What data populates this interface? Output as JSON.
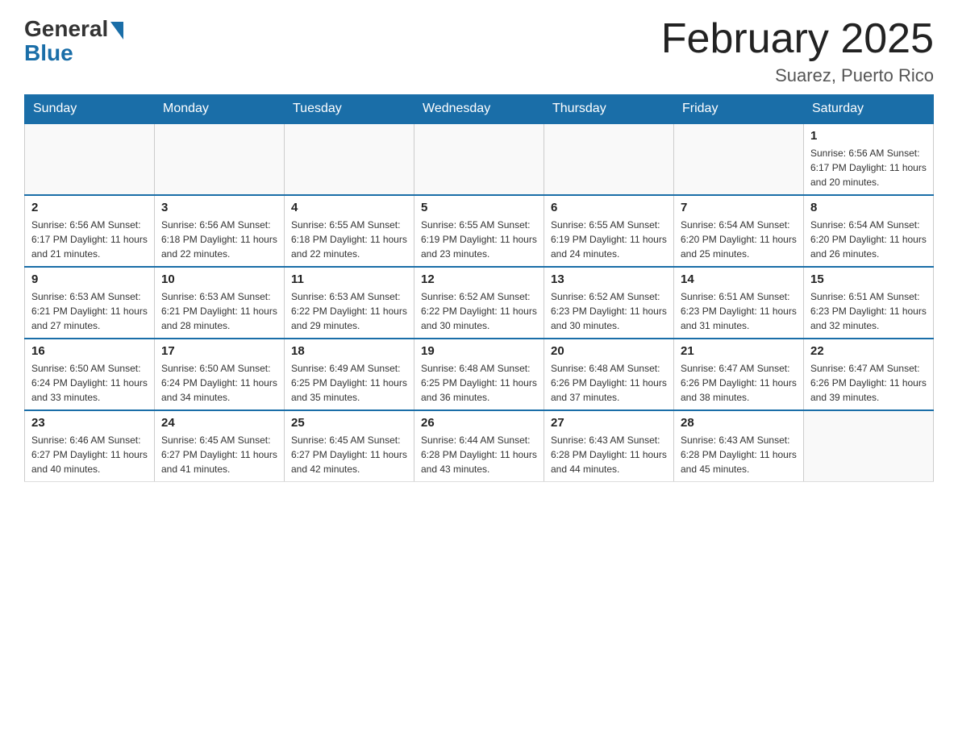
{
  "logo": {
    "general": "General",
    "blue": "Blue"
  },
  "title": "February 2025",
  "subtitle": "Suarez, Puerto Rico",
  "days_of_week": [
    "Sunday",
    "Monday",
    "Tuesday",
    "Wednesday",
    "Thursday",
    "Friday",
    "Saturday"
  ],
  "weeks": [
    [
      {
        "day": "",
        "info": ""
      },
      {
        "day": "",
        "info": ""
      },
      {
        "day": "",
        "info": ""
      },
      {
        "day": "",
        "info": ""
      },
      {
        "day": "",
        "info": ""
      },
      {
        "day": "",
        "info": ""
      },
      {
        "day": "1",
        "info": "Sunrise: 6:56 AM\nSunset: 6:17 PM\nDaylight: 11 hours\nand 20 minutes."
      }
    ],
    [
      {
        "day": "2",
        "info": "Sunrise: 6:56 AM\nSunset: 6:17 PM\nDaylight: 11 hours\nand 21 minutes."
      },
      {
        "day": "3",
        "info": "Sunrise: 6:56 AM\nSunset: 6:18 PM\nDaylight: 11 hours\nand 22 minutes."
      },
      {
        "day": "4",
        "info": "Sunrise: 6:55 AM\nSunset: 6:18 PM\nDaylight: 11 hours\nand 22 minutes."
      },
      {
        "day": "5",
        "info": "Sunrise: 6:55 AM\nSunset: 6:19 PM\nDaylight: 11 hours\nand 23 minutes."
      },
      {
        "day": "6",
        "info": "Sunrise: 6:55 AM\nSunset: 6:19 PM\nDaylight: 11 hours\nand 24 minutes."
      },
      {
        "day": "7",
        "info": "Sunrise: 6:54 AM\nSunset: 6:20 PM\nDaylight: 11 hours\nand 25 minutes."
      },
      {
        "day": "8",
        "info": "Sunrise: 6:54 AM\nSunset: 6:20 PM\nDaylight: 11 hours\nand 26 minutes."
      }
    ],
    [
      {
        "day": "9",
        "info": "Sunrise: 6:53 AM\nSunset: 6:21 PM\nDaylight: 11 hours\nand 27 minutes."
      },
      {
        "day": "10",
        "info": "Sunrise: 6:53 AM\nSunset: 6:21 PM\nDaylight: 11 hours\nand 28 minutes."
      },
      {
        "day": "11",
        "info": "Sunrise: 6:53 AM\nSunset: 6:22 PM\nDaylight: 11 hours\nand 29 minutes."
      },
      {
        "day": "12",
        "info": "Sunrise: 6:52 AM\nSunset: 6:22 PM\nDaylight: 11 hours\nand 30 minutes."
      },
      {
        "day": "13",
        "info": "Sunrise: 6:52 AM\nSunset: 6:23 PM\nDaylight: 11 hours\nand 30 minutes."
      },
      {
        "day": "14",
        "info": "Sunrise: 6:51 AM\nSunset: 6:23 PM\nDaylight: 11 hours\nand 31 minutes."
      },
      {
        "day": "15",
        "info": "Sunrise: 6:51 AM\nSunset: 6:23 PM\nDaylight: 11 hours\nand 32 minutes."
      }
    ],
    [
      {
        "day": "16",
        "info": "Sunrise: 6:50 AM\nSunset: 6:24 PM\nDaylight: 11 hours\nand 33 minutes."
      },
      {
        "day": "17",
        "info": "Sunrise: 6:50 AM\nSunset: 6:24 PM\nDaylight: 11 hours\nand 34 minutes."
      },
      {
        "day": "18",
        "info": "Sunrise: 6:49 AM\nSunset: 6:25 PM\nDaylight: 11 hours\nand 35 minutes."
      },
      {
        "day": "19",
        "info": "Sunrise: 6:48 AM\nSunset: 6:25 PM\nDaylight: 11 hours\nand 36 minutes."
      },
      {
        "day": "20",
        "info": "Sunrise: 6:48 AM\nSunset: 6:26 PM\nDaylight: 11 hours\nand 37 minutes."
      },
      {
        "day": "21",
        "info": "Sunrise: 6:47 AM\nSunset: 6:26 PM\nDaylight: 11 hours\nand 38 minutes."
      },
      {
        "day": "22",
        "info": "Sunrise: 6:47 AM\nSunset: 6:26 PM\nDaylight: 11 hours\nand 39 minutes."
      }
    ],
    [
      {
        "day": "23",
        "info": "Sunrise: 6:46 AM\nSunset: 6:27 PM\nDaylight: 11 hours\nand 40 minutes."
      },
      {
        "day": "24",
        "info": "Sunrise: 6:45 AM\nSunset: 6:27 PM\nDaylight: 11 hours\nand 41 minutes."
      },
      {
        "day": "25",
        "info": "Sunrise: 6:45 AM\nSunset: 6:27 PM\nDaylight: 11 hours\nand 42 minutes."
      },
      {
        "day": "26",
        "info": "Sunrise: 6:44 AM\nSunset: 6:28 PM\nDaylight: 11 hours\nand 43 minutes."
      },
      {
        "day": "27",
        "info": "Sunrise: 6:43 AM\nSunset: 6:28 PM\nDaylight: 11 hours\nand 44 minutes."
      },
      {
        "day": "28",
        "info": "Sunrise: 6:43 AM\nSunset: 6:28 PM\nDaylight: 11 hours\nand 45 minutes."
      },
      {
        "day": "",
        "info": ""
      }
    ]
  ]
}
